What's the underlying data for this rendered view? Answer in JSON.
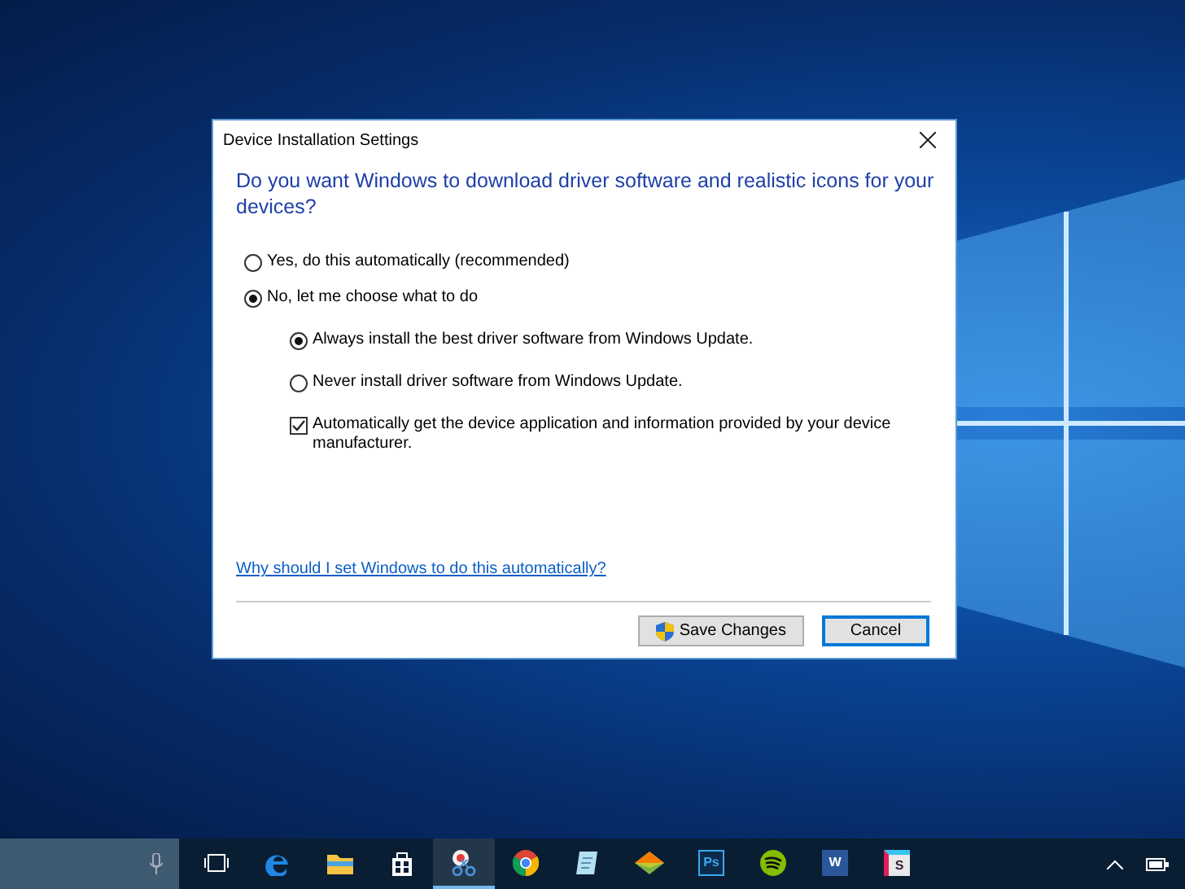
{
  "dialog": {
    "title": "Device Installation Settings",
    "heading": "Do you want Windows to download driver software and realistic icons for your devices?",
    "options": [
      {
        "kind": "radio",
        "label": "Yes, do this automatically (recommended)",
        "selected": false
      },
      {
        "kind": "radio",
        "label": "No, let me choose what to do",
        "selected": true,
        "children": [
          {
            "kind": "radio",
            "label": "Always install the best driver software from Windows Update.",
            "selected": true
          },
          {
            "kind": "radio",
            "label": "Never install driver software from Windows Update.",
            "selected": false
          },
          {
            "kind": "checkbox",
            "label": "Automatically get the device application and information provided by your device manufacturer.",
            "checked": true
          }
        ]
      }
    ],
    "link": "Why should I set Windows to do this automatically?",
    "buttons": [
      {
        "kind": "shield",
        "label": "Save Changes",
        "default": false
      },
      {
        "kind": "plain",
        "label": "Cancel",
        "default": true
      }
    ]
  },
  "taskbar": {
    "apps": [
      {
        "kind": "taskview",
        "selected": false
      },
      {
        "kind": "edge",
        "selected": false
      },
      {
        "kind": "folder",
        "selected": false
      },
      {
        "kind": "store",
        "selected": false
      },
      {
        "kind": "snip",
        "selected": true
      },
      {
        "kind": "chrome",
        "selected": false
      },
      {
        "kind": "notepad",
        "selected": false
      },
      {
        "kind": "gem",
        "selected": false
      },
      {
        "kind": "ps",
        "selected": false,
        "glyph": "Ps"
      },
      {
        "kind": "spotify",
        "selected": false
      },
      {
        "kind": "word",
        "selected": false,
        "glyph": "W"
      },
      {
        "kind": "slack",
        "selected": false,
        "glyph": "S"
      }
    ]
  }
}
